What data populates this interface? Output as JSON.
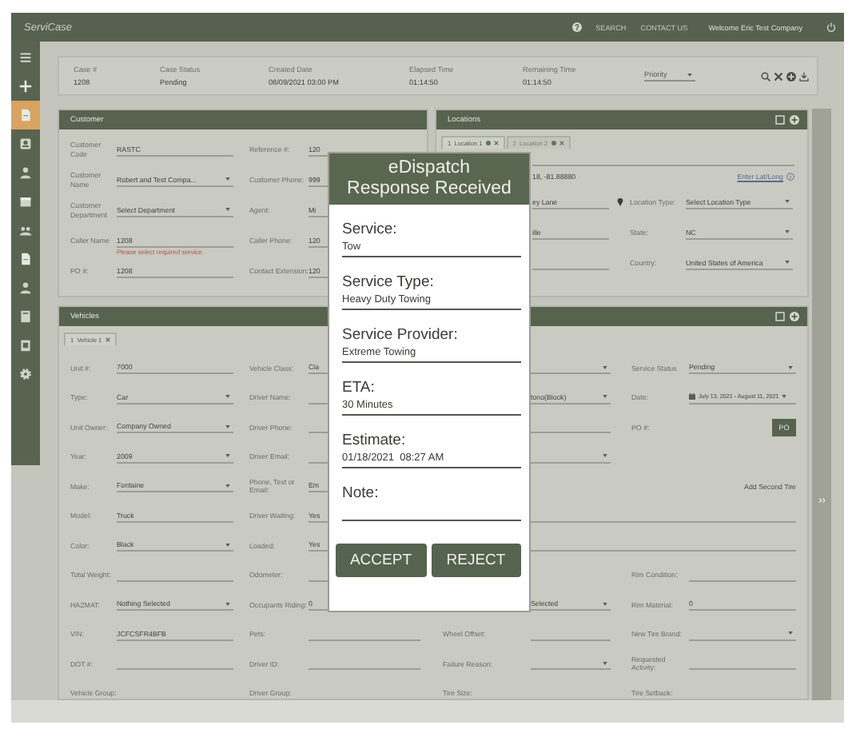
{
  "topbar": {
    "logo": "ServiCase",
    "links": [
      "SEARCH",
      "CONTACT US"
    ],
    "welcome": "Welcome Eric Test Company"
  },
  "sidebar": {
    "items": [
      {
        "selected": false
      },
      {
        "selected": false
      },
      {
        "selected": true
      },
      {
        "selected": false
      },
      {
        "selected": false
      },
      {
        "selected": false
      },
      {
        "selected": false
      },
      {
        "selected": false
      },
      {
        "selected": false
      },
      {
        "selected": false
      },
      {
        "selected": false
      },
      {
        "selected": false
      }
    ]
  },
  "case_header": {
    "fields": [
      {
        "label": "Case #",
        "value": "1208"
      },
      {
        "label": "Case Status",
        "value": "Pending"
      },
      {
        "label": "Created Date",
        "value": "08/09/2021 03:00 PM"
      },
      {
        "label": "Elapsed Time",
        "value": "01:14:50"
      },
      {
        "label": "Remaining Time",
        "value": "01:14:50"
      }
    ],
    "priority": {
      "placeholder": "Priority"
    }
  },
  "customer": {
    "title": "Customer",
    "rows": [
      [
        {
          "label": "Customer Code",
          "value": "RASTC",
          "kind": "input"
        },
        {
          "label": "Reference #:",
          "value": "120",
          "kind": "input"
        }
      ],
      [
        {
          "label": "Customer Name",
          "value": "Robert and Test Compa...",
          "kind": "select"
        },
        {
          "label": "Customer Phone:",
          "value": "999",
          "kind": "input"
        }
      ],
      [
        {
          "label": "Customer Department",
          "value": "Select Department",
          "kind": "select"
        },
        {
          "label": "Agent:",
          "value": "Mi",
          "kind": "input"
        }
      ],
      [
        {
          "label": "Caller Name",
          "value": "1208",
          "kind": "input",
          "error": "Please select required service."
        },
        {
          "label": "Caller Phone:",
          "value": "120",
          "kind": "input"
        }
      ],
      [
        {
          "label": "PO #:",
          "value": "1208",
          "kind": "input"
        },
        {
          "label": "Contact Extension:",
          "value": "120",
          "kind": "input"
        }
      ]
    ]
  },
  "locations": {
    "title": "Locations",
    "tabs": [
      {
        "number": "1",
        "label": "Location 1",
        "selected": true
      },
      {
        "number": "2",
        "label": "Location 2",
        "selected": false
      }
    ],
    "coordinates": "18, -81.88880",
    "lat_long_link": "Enter Lat/Long",
    "rows": [
      [
        {
          "value": "ey Lane",
          "kind": "input",
          "pin": true
        },
        {
          "label": "Location Type:",
          "value": "Select Location Type",
          "kind": "select"
        }
      ],
      [
        {
          "value": "ille",
          "kind": "input",
          "pin": false
        },
        {
          "label": "State:",
          "value": "NC",
          "kind": "select"
        }
      ],
      [
        {
          "kind": "input",
          "pin": false
        },
        {
          "label": "Country:",
          "value": "United States of America",
          "kind": "select"
        }
      ]
    ]
  },
  "vehicles": {
    "title": "Vehicles",
    "tabs": [
      {
        "number": "1",
        "label": "Vehicle 1",
        "selected": true
      }
    ],
    "rows": [
      [
        {
          "label": "Unit #:",
          "value": "7000",
          "kind": "input"
        },
        {
          "label": "Vehicle Class:",
          "value": "Cla",
          "kind": "input"
        },
        {
          "kind": "select"
        },
        {
          "label": "Service Status",
          "value": "Pending",
          "kind": "select"
        }
      ],
      [
        {
          "label": "Type:",
          "value": "Car",
          "kind": "select"
        },
        {
          "label": "Driver Name:",
          "kind": "input"
        },
        {
          "value": "tono(Block)",
          "kind": "select"
        },
        {
          "label": "Date:",
          "value": "July 13, 2021 - August 11, 2021",
          "kind": "date"
        }
      ],
      [
        {
          "label": "Unit Owner:",
          "value": "Company Owned",
          "kind": "select"
        },
        {
          "label": "Driver Phone:",
          "kind": "input"
        },
        {
          "kind": "input"
        },
        {
          "label": "PO #:",
          "kind": "po",
          "button": "PO"
        }
      ],
      [
        {
          "label": "Year:",
          "value": "2009",
          "kind": "select"
        },
        {
          "label": "Driver Email:",
          "kind": "input"
        },
        {
          "kind": "select"
        },
        null
      ],
      [
        {
          "label": "Make:",
          "value": "Fontaine",
          "kind": "select"
        },
        {
          "label": "Phone, Text or Email:",
          "value": "Em",
          "kind": "input"
        },
        null,
        {
          "value": "Add Second Tire",
          "kind": "link"
        }
      ],
      [
        {
          "label": "Model:",
          "value": "Truck",
          "kind": "input"
        },
        {
          "label": "Driver Waiting:",
          "value": "Yes",
          "kind": "input"
        },
        {
          "kind": "wide"
        },
        null
      ],
      [
        {
          "label": "Color:",
          "value": "Black",
          "kind": "select"
        },
        {
          "label": "Loaded:",
          "value": "Yes",
          "kind": "input"
        },
        {
          "kind": "wide"
        },
        null
      ],
      [
        {
          "label": "Total Weight:",
          "kind": "input"
        },
        {
          "label": "Odometer:",
          "kind": "input"
        },
        null,
        {
          "label": "Rim Condition:",
          "kind": "input"
        }
      ],
      [
        {
          "label": "HAZMAT:",
          "value": "Nothing Selected",
          "kind": "select"
        },
        {
          "label": "Occupants Riding:",
          "value": "0",
          "kind": "input"
        },
        {
          "value": "Selected",
          "kind": "select"
        },
        {
          "label": "Rim Material:",
          "value": "0",
          "kind": "input"
        }
      ],
      [
        {
          "label": "VIN:",
          "value": "JCFCSFR4BFB",
          "kind": "input"
        },
        {
          "label": "Pets:",
          "kind": "input"
        },
        {
          "label": "Wheel Offset:",
          "kind": "input"
        },
        {
          "label": "New Tire Brand:",
          "kind": "select"
        }
      ],
      [
        {
          "label": "DOT #:",
          "kind": "input"
        },
        {
          "label": "Driver ID:",
          "kind": "input"
        },
        {
          "label": "Failure Reason:",
          "kind": "select"
        },
        {
          "label": "Requested Activity:",
          "kind": "input"
        }
      ],
      [
        {
          "label": "Vehicle Group:",
          "kind": "label"
        },
        {
          "label": "Driver Group:",
          "kind": "label"
        },
        {
          "label": "Tire Size:",
          "kind": "label"
        },
        {
          "label": "Tire Setback:",
          "kind": "label"
        }
      ]
    ]
  },
  "modal": {
    "title": "eDispatch\nResponse Received",
    "fields": [
      {
        "label": "Service:",
        "value": "Tow"
      },
      {
        "label": "Service Type:",
        "value": "Heavy Duty Towing"
      },
      {
        "label": "Service Provider:",
        "value": "Extreme Towing"
      },
      {
        "label": "ETA:",
        "value": "30 Minutes"
      },
      {
        "label": "Estimate:",
        "value": "01/18/2021  08:27 AM"
      },
      {
        "label": "Note:"
      }
    ],
    "buttons": [
      "ACCEPT",
      "REJECT"
    ]
  }
}
